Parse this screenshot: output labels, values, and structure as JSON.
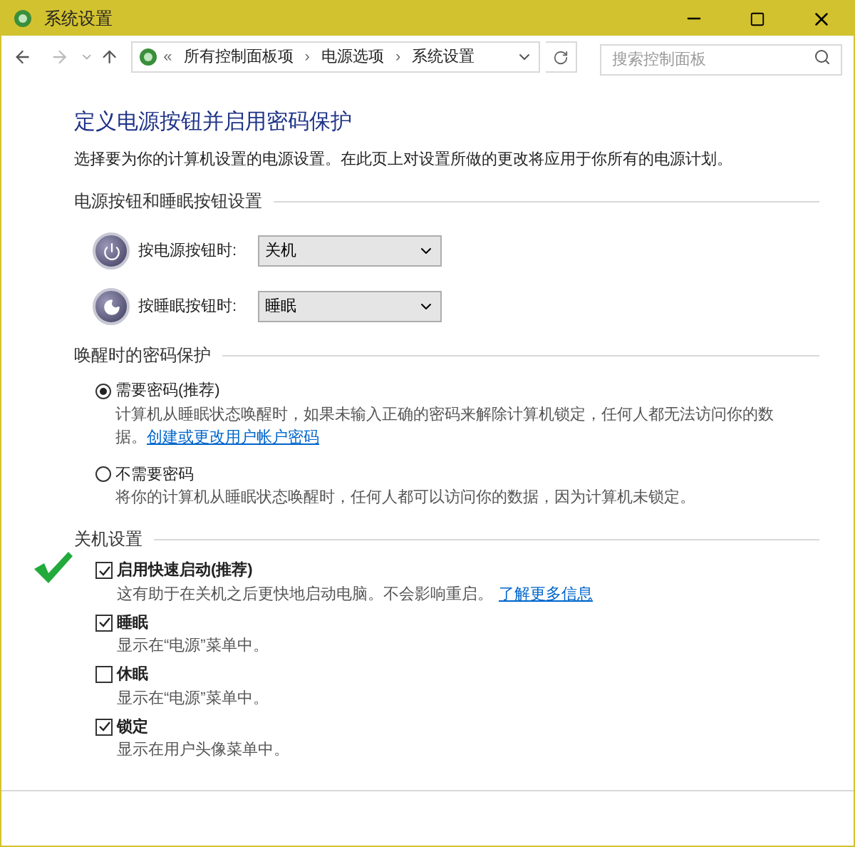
{
  "window": {
    "title": "系统设置"
  },
  "address_bar": {
    "overflow": "«",
    "crumbs": [
      "所有控制面板项",
      "电源选项",
      "系统设置"
    ],
    "separator": "›"
  },
  "search": {
    "placeholder": "搜索控制面板"
  },
  "heading": "定义电源按钮并启用密码保护",
  "description": "选择要为你的计算机设置的电源设置。在此页上对设置所做的更改将应用于你所有的电源计划。",
  "button_section": {
    "title": "电源按钮和睡眠按钮设置",
    "rows": [
      {
        "kind": "power",
        "label": "按电源按钮时:",
        "value": "关机"
      },
      {
        "kind": "sleep",
        "label": "按睡眠按钮时:",
        "value": "睡眠"
      }
    ]
  },
  "password_section": {
    "title": "唤醒时的密码保护",
    "options": [
      {
        "label": "需要密码(推荐)",
        "selected": true,
        "description": "计算机从睡眠状态唤醒时，如果未输入正确的密码来解除计算机锁定，任何人都无法访问你的数据。",
        "link": "创建或更改用户帐户密码"
      },
      {
        "label": "不需要密码",
        "selected": false,
        "description": "将你的计算机从睡眠状态唤醒时，任何人都可以访问你的数据，因为计算机未锁定。"
      }
    ]
  },
  "shutdown_section": {
    "title": "关机设置",
    "items": [
      {
        "label": "启用快速启动(推荐)",
        "checked": true,
        "annotated": true,
        "description": "这有助于在关机之后更快地启动电脑。不会影响重启。",
        "link": "了解更多信息"
      },
      {
        "label": "睡眠",
        "checked": true,
        "annotated": false,
        "description": "显示在“电源”菜单中。"
      },
      {
        "label": "休眠",
        "checked": false,
        "annotated": false,
        "description": "显示在“电源”菜单中。"
      },
      {
        "label": "锁定",
        "checked": true,
        "annotated": false,
        "description": "显示在用户头像菜单中。"
      }
    ]
  }
}
